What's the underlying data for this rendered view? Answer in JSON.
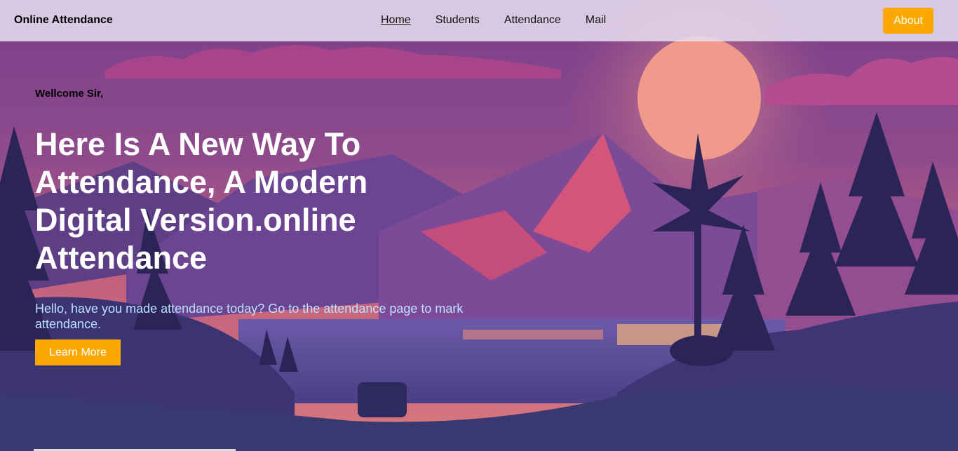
{
  "navbar": {
    "brand": "Online Attendance",
    "links": [
      {
        "label": "Home"
      },
      {
        "label": "Students"
      },
      {
        "label": "Attendance"
      },
      {
        "label": "Mail"
      }
    ],
    "about_label": "About"
  },
  "hero": {
    "greeting": "Wellcome Sir,",
    "headline": "Here Is A New Way To Attendance, A Modern Digital Version.online Attendance",
    "subtext": "Hello, have you made attendance today? Go to the attendance page to mark attendance.",
    "button_label": "Learn More"
  },
  "colors": {
    "accent": "#fca800",
    "subtext": "#bde0ff",
    "sky_top": "#6d3f85",
    "sun": "#f09a8c"
  },
  "background": {
    "scene": "mountain-lake-sunset-illustration"
  }
}
